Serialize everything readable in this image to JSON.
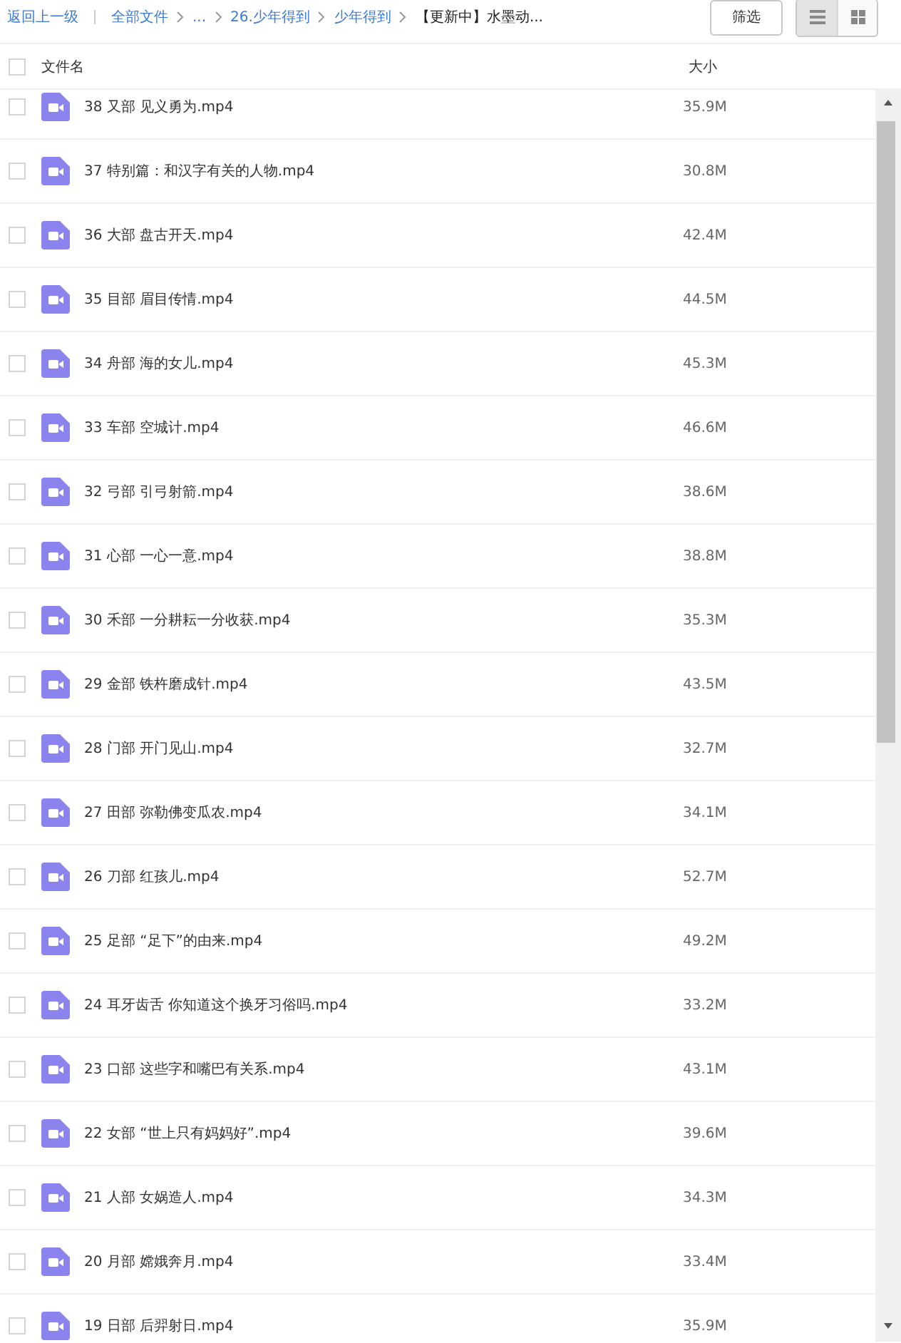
{
  "breadcrumb": [
    {
      "kind": "back",
      "label": "返回上一级"
    },
    {
      "kind": "link",
      "label": "全部文件"
    },
    {
      "kind": "link",
      "label": "..."
    },
    {
      "kind": "link",
      "label": "26.少年得到"
    },
    {
      "kind": "link",
      "label": "少年得到"
    },
    {
      "kind": "current",
      "label": "【更新中】水墨动..."
    }
  ],
  "filter_button": "筛选",
  "view_toggle": [
    {
      "kind": "list",
      "selected": true
    },
    {
      "kind": "grid",
      "selected": false
    }
  ],
  "header": {
    "select_all_checked": false,
    "columns": [
      "文件名",
      "大小"
    ]
  },
  "rows": [
    {
      "name": "38 又部 见义勇为.mp4",
      "size": "35.9M",
      "checked": false
    },
    {
      "name": "37 特别篇：和汉字有关的人物.mp4",
      "size": "30.8M",
      "checked": false
    },
    {
      "name": "36 大部 盘古开天.mp4",
      "size": "42.4M",
      "checked": false
    },
    {
      "name": "35 目部 眉目传情.mp4",
      "size": "44.5M",
      "checked": false
    },
    {
      "name": "34 舟部 海的女儿.mp4",
      "size": "45.3M",
      "checked": false
    },
    {
      "name": "33 车部 空城计.mp4",
      "size": "46.6M",
      "checked": false
    },
    {
      "name": "32 弓部 引弓射箭.mp4",
      "size": "38.6M",
      "checked": false
    },
    {
      "name": "31 心部 一心一意.mp4",
      "size": "38.8M",
      "checked": false
    },
    {
      "name": "30 禾部 一分耕耘一分收获.mp4",
      "size": "35.3M",
      "checked": false
    },
    {
      "name": "29 金部 铁杵磨成针.mp4",
      "size": "43.5M",
      "checked": false
    },
    {
      "name": "28 门部 开门见山.mp4",
      "size": "32.7M",
      "checked": false
    },
    {
      "name": "27 田部 弥勒佛变瓜农.mp4",
      "size": "34.1M",
      "checked": false
    },
    {
      "name": "26 刀部 红孩儿.mp4",
      "size": "52.7M",
      "checked": false
    },
    {
      "name": "25 足部 “足下”的由来.mp4",
      "size": "49.2M",
      "checked": false
    },
    {
      "name": "24 耳牙齿舌 你知道这个换牙习俗吗.mp4",
      "size": "33.2M",
      "checked": false
    },
    {
      "name": "23 口部 这些字和嘴巴有关系.mp4",
      "size": "43.1M",
      "checked": false
    },
    {
      "name": "22 女部 “世上只有妈妈好”.mp4",
      "size": "39.6M",
      "checked": false
    },
    {
      "name": "21 人部 女娲造人.mp4",
      "size": "34.3M",
      "checked": false
    },
    {
      "name": "20 月部 嫦娥奔月.mp4",
      "size": "33.4M",
      "checked": false
    },
    {
      "name": "19 日部 后羿射日.mp4",
      "size": "35.9M",
      "checked": false
    }
  ]
}
